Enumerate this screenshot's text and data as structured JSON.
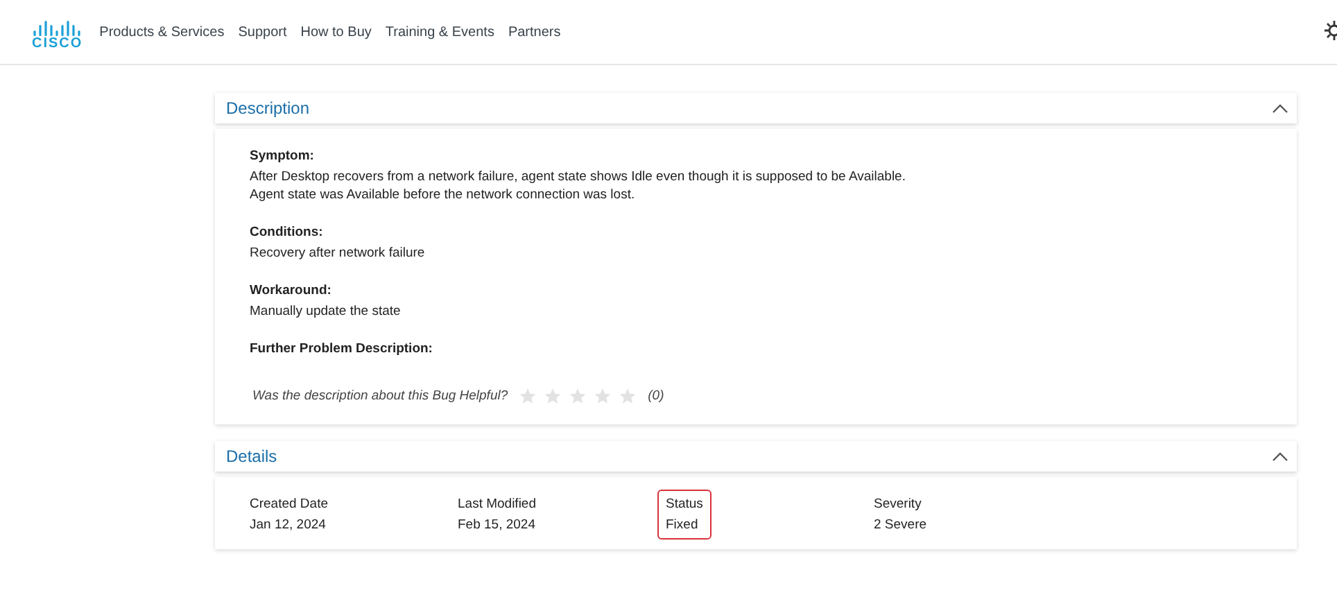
{
  "nav": {
    "logo": "CISCO",
    "items": [
      "Products & Services",
      "Support",
      "How to Buy",
      "Training & Events",
      "Partners"
    ]
  },
  "description": {
    "title": "Description",
    "expanded": true,
    "blocks": [
      {
        "heading": "Symptom:",
        "lines": [
          "After Desktop recovers from a network failure, agent state shows Idle even though it is supposed to be Available.",
          "Agent state was Available before the network connection was lost."
        ]
      },
      {
        "heading": "Conditions:",
        "lines": [
          "Recovery after network failure"
        ]
      },
      {
        "heading": "Workaround:",
        "lines": [
          "Manually update the state"
        ]
      },
      {
        "heading": "Further Problem Description:"
      }
    ],
    "rating": {
      "question": "Was the description about this Bug Helpful?",
      "stars": 0,
      "count": "(0)"
    }
  },
  "details": {
    "title": "Details",
    "expanded": true,
    "fields": [
      {
        "label": "Created Date",
        "value": "Jan 12, 2024",
        "highlighted": false
      },
      {
        "label": "Last Modified",
        "value": "Feb 15, 2024",
        "highlighted": false
      },
      {
        "label": "Status",
        "value": "Fixed",
        "highlighted": true
      },
      {
        "label": "Severity",
        "value": "2 Severe",
        "highlighted": false
      }
    ]
  }
}
